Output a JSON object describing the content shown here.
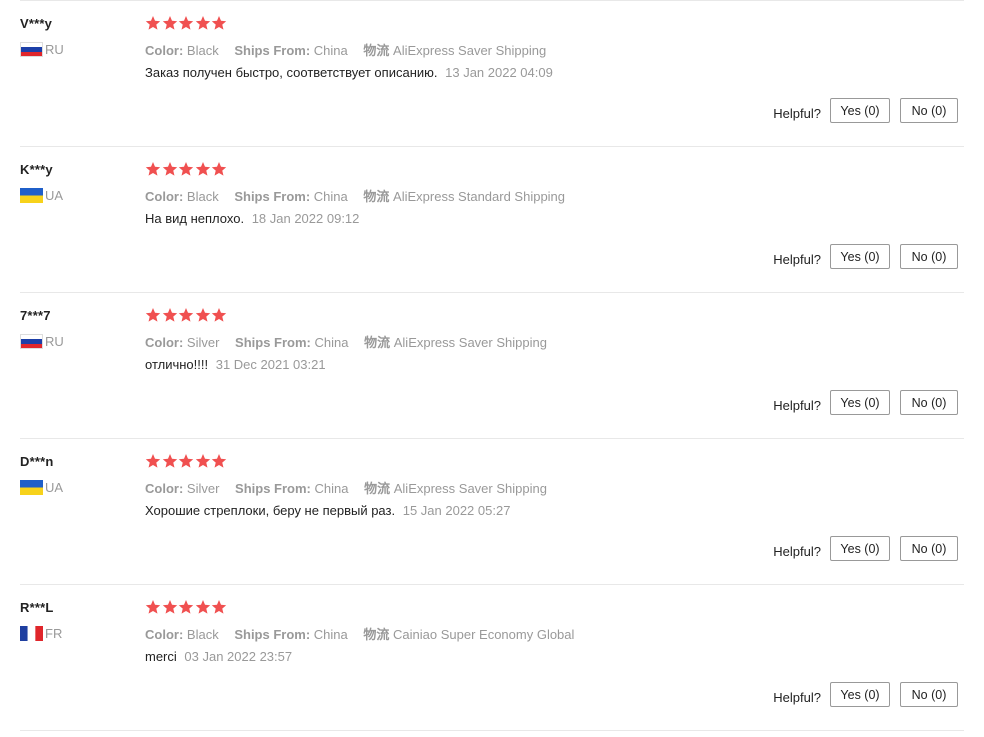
{
  "labels": {
    "color_key": "Color:",
    "ships_key": "Ships From:",
    "shipping_key": "物流",
    "helpful": "Helpful?"
  },
  "colors": {
    "star": "#f05050",
    "muted_text": "#999999"
  },
  "reviews": [
    {
      "user": "V***y",
      "country": "RU",
      "flag": "russia-flag-icon",
      "stars": 5,
      "color": "Black",
      "ships_from": "China",
      "shipping": "AliExpress Saver Shipping",
      "text": "Заказ получен быстро, соответствует описанию.",
      "date": "13 Jan 2022 04:09",
      "yes": "Yes (0)",
      "no": "No (0)"
    },
    {
      "user": "K***y",
      "country": "UA",
      "flag": "ukraine-flag-icon",
      "stars": 5,
      "color": "Black",
      "ships_from": "China",
      "shipping": "AliExpress Standard Shipping",
      "text": "На вид неплохо.",
      "date": "18 Jan 2022 09:12",
      "yes": "Yes (0)",
      "no": "No (0)"
    },
    {
      "user": "7***7",
      "country": "RU",
      "flag": "russia-flag-icon",
      "stars": 5,
      "color": "Silver",
      "ships_from": "China",
      "shipping": "AliExpress Saver Shipping",
      "text": "отлично!!!!",
      "date": "31 Dec 2021 03:21",
      "yes": "Yes (0)",
      "no": "No (0)"
    },
    {
      "user": "D***n",
      "country": "UA",
      "flag": "ukraine-flag-icon",
      "stars": 5,
      "color": "Silver",
      "ships_from": "China",
      "shipping": "AliExpress Saver Shipping",
      "text": "Хорошие стреплоки, беру не первый раз.",
      "date": "15 Jan 2022 05:27",
      "yes": "Yes (0)",
      "no": "No (0)"
    },
    {
      "user": "R***L",
      "country": "FR",
      "flag": "france-flag-icon",
      "stars": 5,
      "color": "Black",
      "ships_from": "China",
      "shipping": "Cainiao Super Economy Global",
      "text": "merci",
      "date": "03 Jan 2022 23:57",
      "yes": "Yes (0)",
      "no": "No (0)"
    }
  ]
}
